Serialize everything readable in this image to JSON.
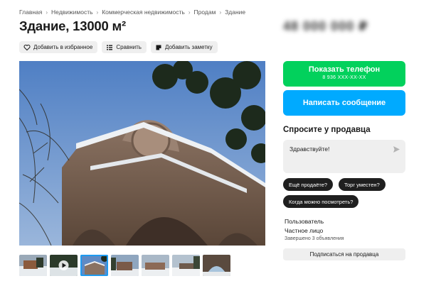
{
  "breadcrumb": [
    "Главная",
    "Недвижимость",
    "Коммерческая недвижимость",
    "Продам",
    "Здание"
  ],
  "title": "Здание, 13000 м²",
  "price": "48 000 000 ₽",
  "actions": {
    "favorite": "Добавить в избранное",
    "compare": "Сравнить",
    "note": "Добавить заметку"
  },
  "contact": {
    "show_phone": "Показать телефон",
    "phone_masked": "8 936 XXX-XX-XX",
    "write_message": "Написать сообщение"
  },
  "ask": {
    "title": "Спросите у продавца",
    "message_value": "Здравствуйте!",
    "quick_questions": [
      "Ещё продаёте?",
      "Торг уместен?",
      "Когда можно посмотреть?"
    ]
  },
  "seller": {
    "type": "Пользователь",
    "name": "Частное лицо",
    "stats": "Завершено 3 объявления",
    "subscribe": "Подписаться на продавца"
  },
  "gallery": {
    "thumbnail_count": 7,
    "active_index": 2,
    "video_index": 1,
    "colors": {
      "sky": "#6f95c9",
      "stone": "#8a7262",
      "snow": "#eef1f4"
    }
  }
}
